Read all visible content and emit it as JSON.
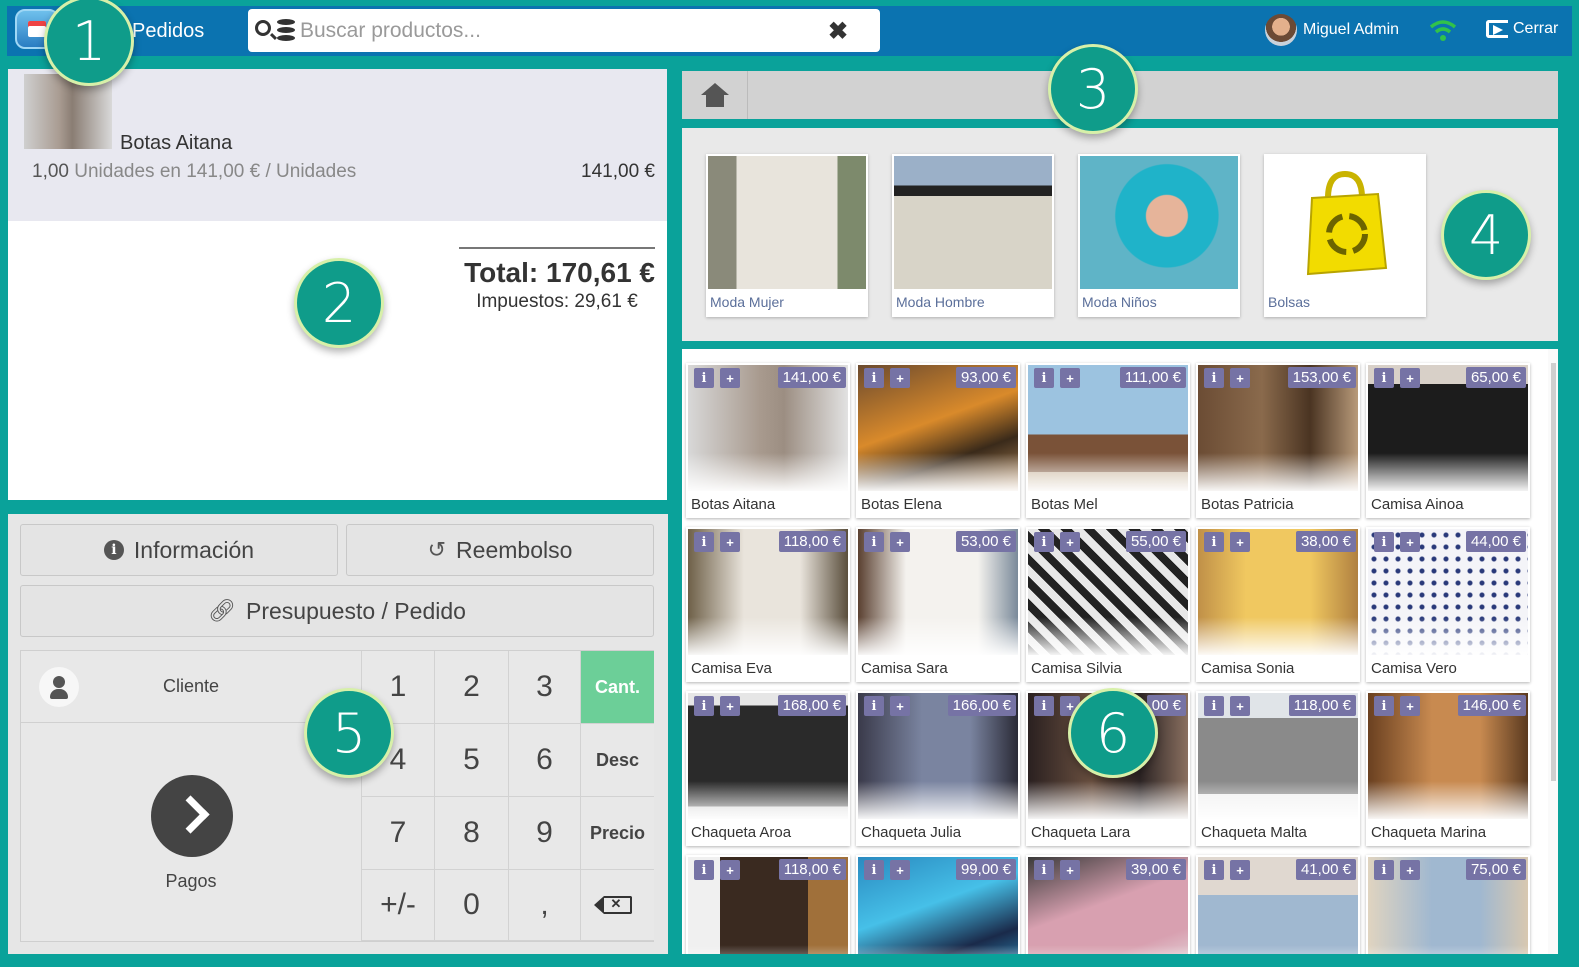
{
  "topbar": {
    "title": "Pedidos",
    "search_placeholder": "Buscar productos...",
    "clear_glyph": "✖",
    "user_name": "Miguel Admin",
    "logout_label": "Cerrar",
    "bar_color": "#0b73b0"
  },
  "order": {
    "lines": [
      {
        "name": "Botas Aitana",
        "qty": "1,00",
        "detail": " Unidades en 141,00 € / Unidades",
        "total": "141,00 €"
      }
    ],
    "total": "Total: 170,61 €",
    "taxes": "Impuestos: 29,61 €"
  },
  "actions": {
    "info": "Información",
    "refund": "Reembolso",
    "quote": "Presupuesto / Pedido"
  },
  "pad": {
    "client": "Cliente",
    "payments": "Pagos",
    "keys": [
      "1",
      "2",
      "3",
      "Cant.",
      "4",
      "5",
      "6",
      "Desc",
      "7",
      "8",
      "9",
      "Precio",
      "+/-",
      "0",
      ",",
      "⌫"
    ],
    "active_key": "Cant.",
    "active_color": "#6ccf98"
  },
  "categories": [
    {
      "label": "Moda Mujer",
      "icon": "category-woman-image"
    },
    {
      "label": "Moda Hombre",
      "icon": "category-man-image"
    },
    {
      "label": "Moda Niños",
      "icon": "category-kids-image"
    },
    {
      "label": "Bolsas",
      "icon": "bag-icon"
    }
  ],
  "products": [
    {
      "name": "Botas Aitana",
      "price": "141,00 €"
    },
    {
      "name": "Botas Elena",
      "price": "93,00 €"
    },
    {
      "name": "Botas Mel",
      "price": "111,00 €"
    },
    {
      "name": "Botas Patricia",
      "price": "153,00 €"
    },
    {
      "name": "Camisa Ainoa",
      "price": "65,00 €"
    },
    {
      "name": "Camisa Eva",
      "price": "118,00 €"
    },
    {
      "name": "Camisa Sara",
      "price": "53,00 €"
    },
    {
      "name": "Camisa Silvia",
      "price": "55,00 €"
    },
    {
      "name": "Camisa Sonia",
      "price": "38,00 €"
    },
    {
      "name": "Camisa Vero",
      "price": "44,00 €"
    },
    {
      "name": "Chaqueta Aroa",
      "price": "168,00 €"
    },
    {
      "name": "Chaqueta Julia",
      "price": "166,00 €"
    },
    {
      "name": "Chaqueta Lara",
      "price": "00 €"
    },
    {
      "name": "Chaqueta Malta",
      "price": "118,00 €"
    },
    {
      "name": "Chaqueta Marina",
      "price": "146,00 €"
    },
    {
      "name": "",
      "price": "118,00 €"
    },
    {
      "name": "",
      "price": "99,00 €"
    },
    {
      "name": "",
      "price": "39,00 €"
    },
    {
      "name": "",
      "price": "41,00 €"
    },
    {
      "name": "",
      "price": "75,00 €"
    }
  ],
  "product_badges": {
    "info": "i",
    "add": "+"
  },
  "markers": [
    "1",
    "2",
    "3",
    "4",
    "5",
    "6"
  ],
  "accent_color": "#0aa29a",
  "price_badge_color": "#7673a5"
}
